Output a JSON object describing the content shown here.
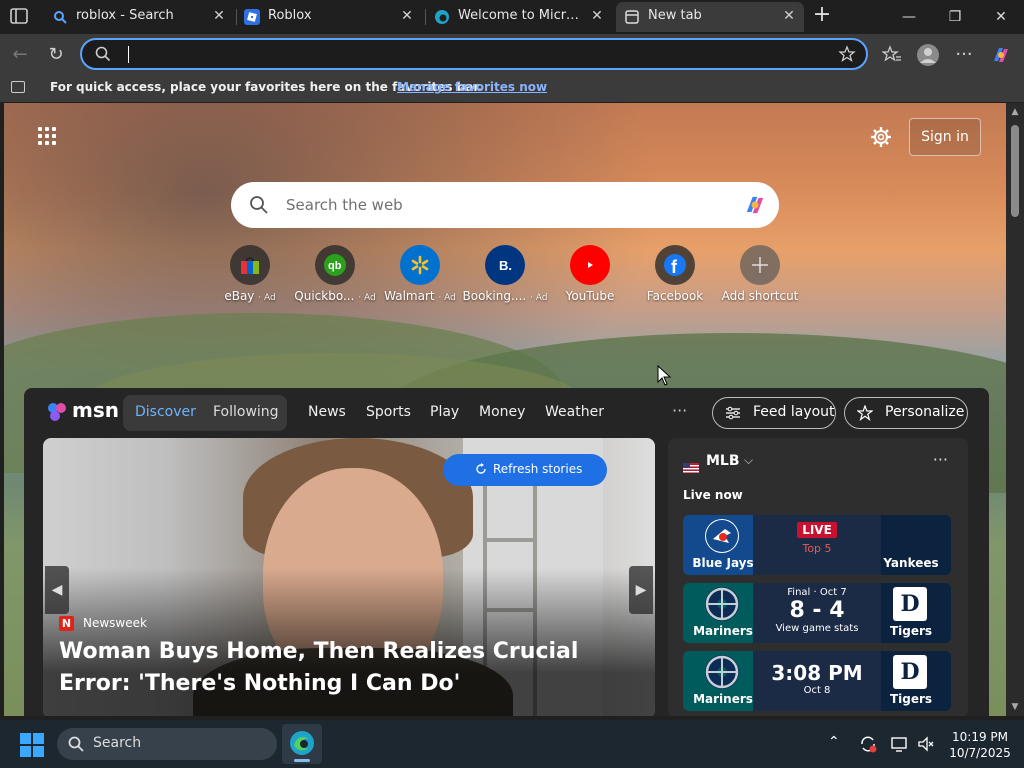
{
  "browser": {
    "tabs": [
      {
        "title": "roblox - Search",
        "active": false
      },
      {
        "title": "Roblox",
        "active": false
      },
      {
        "title": "Welcome to Microsoft Edge",
        "active": false
      },
      {
        "title": "New tab",
        "active": true
      }
    ],
    "address": {
      "value": "",
      "placeholder": ""
    },
    "favorites_bar": {
      "message": "For quick access, place your favorites here on the favorites bar.",
      "link": "Manage favorites now"
    }
  },
  "newtab": {
    "sign_in": "Sign in",
    "search_placeholder": "Search the web",
    "shortcuts": [
      {
        "label": "eBay",
        "ad": "· Ad"
      },
      {
        "label": "Quickbo...",
        "ad": "· Ad"
      },
      {
        "label": "Walmart",
        "ad": "· Ad"
      },
      {
        "label": "Booking....",
        "ad": "· Ad"
      },
      {
        "label": "YouTube",
        "ad": ""
      },
      {
        "label": "Facebook",
        "ad": ""
      },
      {
        "label": "Add shortcut",
        "ad": ""
      }
    ]
  },
  "feed": {
    "logo": "msn",
    "segments": [
      "Discover",
      "Following"
    ],
    "nav": [
      "News",
      "Sports",
      "Play",
      "Money",
      "Weather"
    ],
    "more": "···",
    "feed_layout": "Feed layout",
    "personalize": "Personalize",
    "story": {
      "refresh": "Refresh stories",
      "source": "Newsweek",
      "source_badge": "N",
      "headline": "Woman Buys Home, Then Realizes Crucial Error: 'There's Nothing I Can Do'"
    },
    "mlb": {
      "title": "MLB",
      "live_now": "Live now",
      "games": [
        {
          "left": "Blue Jays",
          "right": "Yankees",
          "status": "LIVE",
          "detail": "Top 5"
        },
        {
          "left": "Mariners",
          "right": "Tigers",
          "status": "Final · Oct 7",
          "score": "8 - 4",
          "detail": "View game stats"
        },
        {
          "left": "Mariners",
          "right": "Tigers",
          "time": "3:08 PM",
          "detail": "Oct 8"
        }
      ]
    }
  },
  "taskbar": {
    "search": "Search",
    "time": "10:19 PM",
    "date": "10/7/2025"
  },
  "colors": {
    "accent": "#5aa3ff",
    "live": "#c9102e",
    "refresh": "#1f6fe5"
  }
}
